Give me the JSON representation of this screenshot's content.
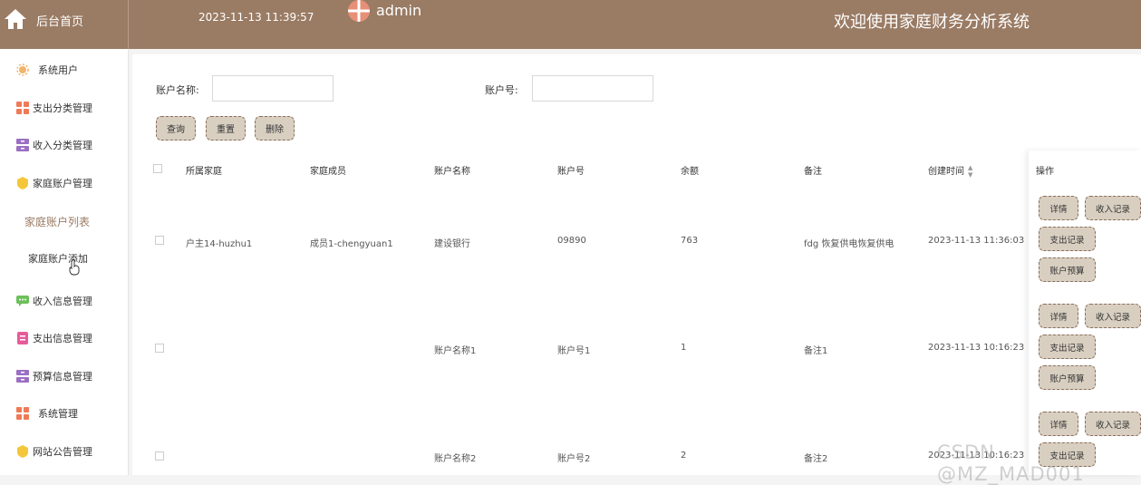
{
  "header": {
    "home_title": "后台首页",
    "datetime": "2023-11-13 11:39:57",
    "user": "admin",
    "site_title": "欢迎使用家庭财务分析系统"
  },
  "sidebar": {
    "items": [
      {
        "label": "系统用户",
        "icon": "gear-sun-icon"
      },
      {
        "label": "支出分类管理",
        "icon": "grid-icon"
      },
      {
        "label": "收入分类管理",
        "icon": "drawer-icon"
      },
      {
        "label": "家庭账户管理",
        "icon": "shield-icon"
      },
      {
        "label": "家庭账户列表",
        "icon": ""
      },
      {
        "label": "家庭账户添加",
        "icon": ""
      },
      {
        "label": "收入信息管理",
        "icon": "chat-icon"
      },
      {
        "label": "支出信息管理",
        "icon": "receipt-icon"
      },
      {
        "label": "预算信息管理",
        "icon": "drawer-icon"
      },
      {
        "label": "系统管理",
        "icon": "grid-icon"
      },
      {
        "label": "网站公告管理",
        "icon": "shield-icon"
      }
    ]
  },
  "search": {
    "account_name_label": "账户名称:",
    "account_name_value": "",
    "account_no_label": "账户号:",
    "account_no_value": "",
    "query_btn": "查询",
    "reset_btn": "重置",
    "delete_btn": "删除"
  },
  "table": {
    "headers": [
      "所属家庭",
      "家庭成员",
      "账户名称",
      "账户号",
      "余额",
      "备注",
      "创建时间",
      "操作"
    ],
    "rows": [
      {
        "family": "户主14-huzhu1",
        "member": "成员1-chengyuan1",
        "name": "建设银行",
        "no": "09890",
        "balance": "763",
        "remark": "fdg 恢复供电恢复供电",
        "created": "2023-11-13 11:36:03"
      },
      {
        "family": "",
        "member": "",
        "name": "账户名称1",
        "no": "账户号1",
        "balance": "1",
        "remark": "备注1",
        "created": "2023-11-13 10:16:23"
      },
      {
        "family": "",
        "member": "",
        "name": "账户名称2",
        "no": "账户号2",
        "balance": "2",
        "remark": "备注2",
        "created": "2023-11-13 10:16:23"
      }
    ],
    "ops": {
      "detail": "详情",
      "income": "收入记录",
      "expense": "支出记录",
      "budget": "账户预算"
    }
  },
  "watermark": "CSDN @MZ_MAD001",
  "colors": {
    "header": "#9a7b64",
    "button": "#d8cfc1",
    "button_border": "#8a6f5c"
  }
}
